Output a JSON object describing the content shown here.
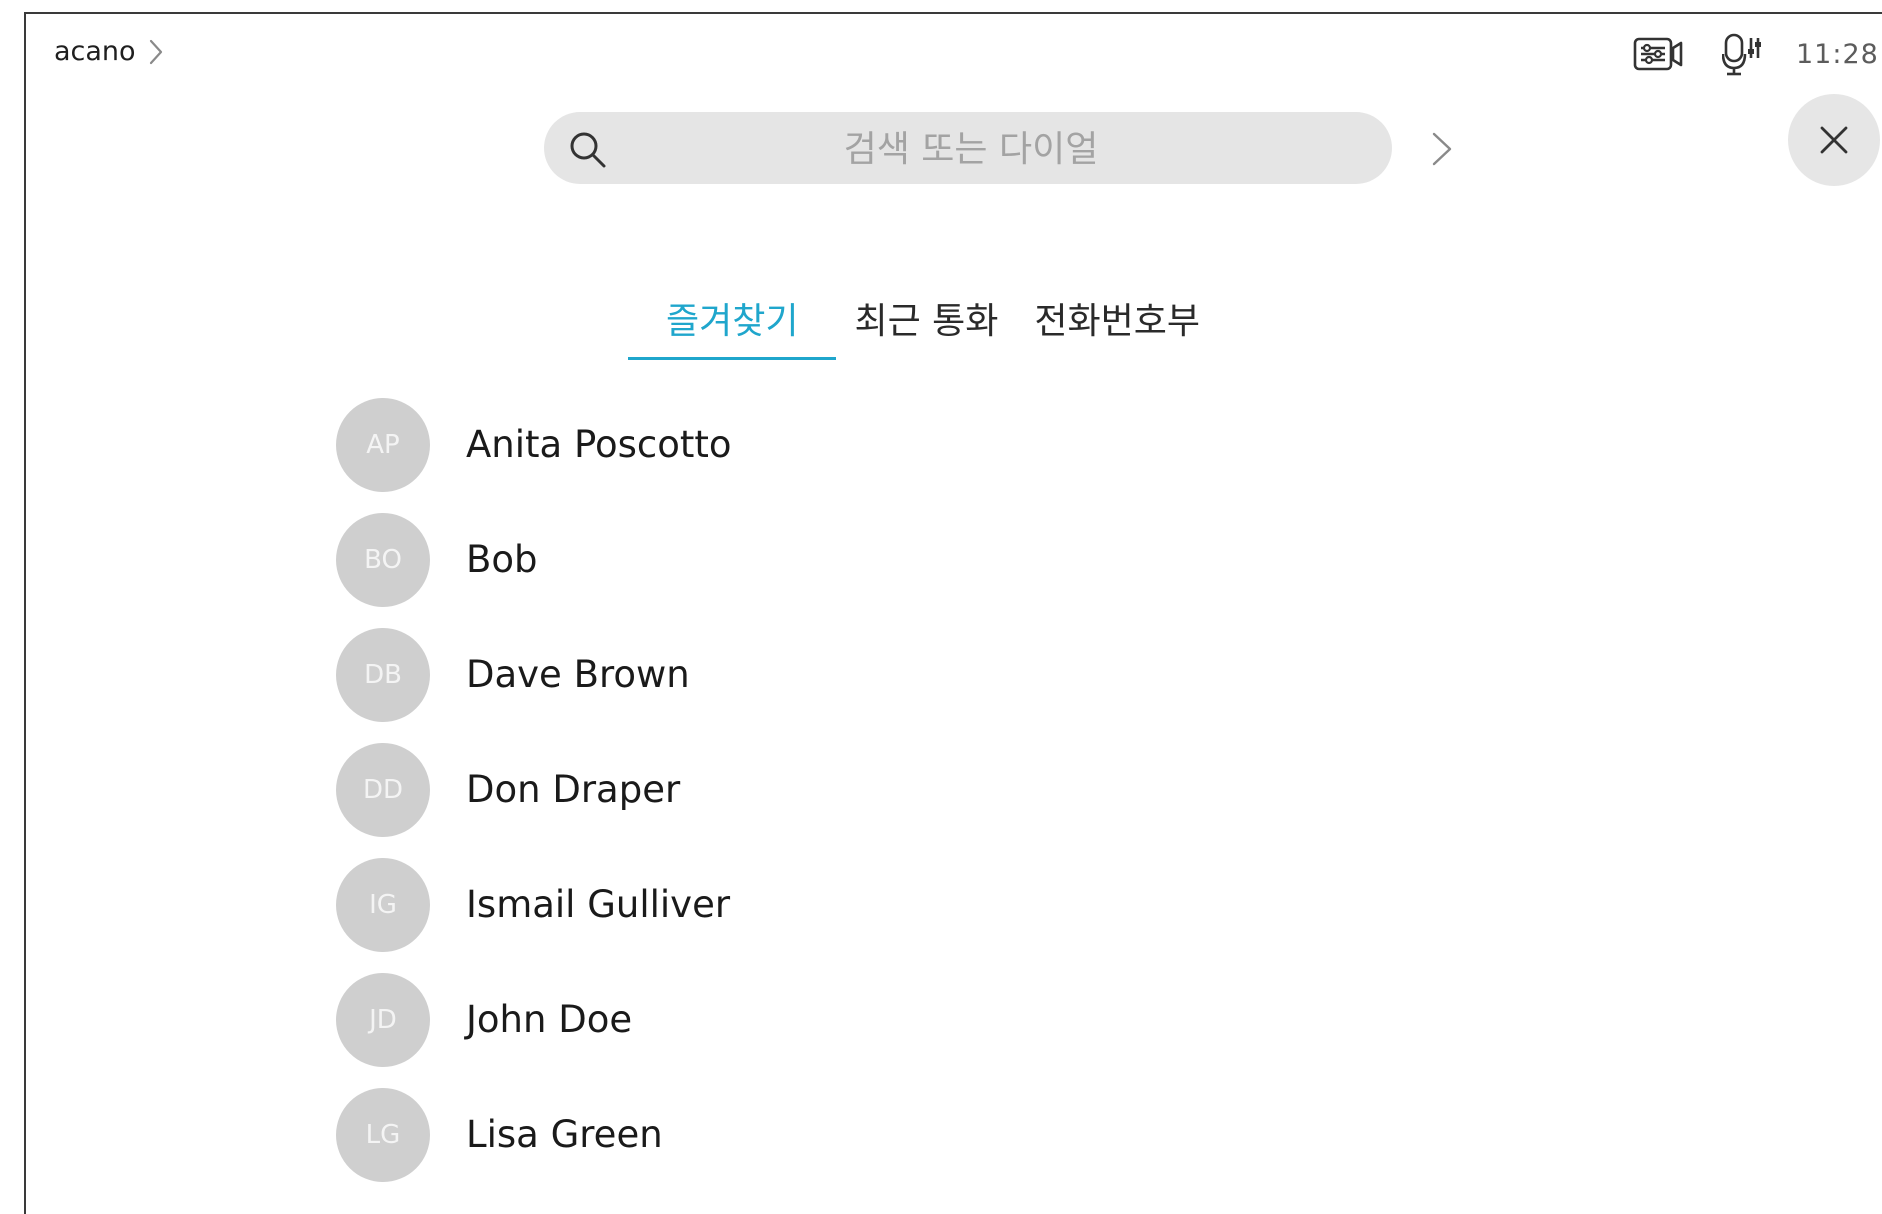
{
  "header": {
    "breadcrumb_label": "acano",
    "clock": "11:28"
  },
  "icons": {
    "breadcrumb_chevron": "chevron-right-icon",
    "camera_settings": "camera-settings-icon",
    "mic_settings": "microphone-settings-icon",
    "search": "search-icon",
    "search_go": "chevron-right-icon",
    "close": "close-icon"
  },
  "search": {
    "placeholder": "검색 또는 다이얼",
    "value": ""
  },
  "tabs": [
    {
      "label": "즐겨찾기",
      "active": true
    },
    {
      "label": "최근 통화",
      "active": false
    },
    {
      "label": "전화번호부",
      "active": false
    }
  ],
  "contacts": [
    {
      "initials": "AP",
      "name": "Anita Poscotto"
    },
    {
      "initials": "BO",
      "name": "Bob"
    },
    {
      "initials": "DB",
      "name": "Dave Brown"
    },
    {
      "initials": "DD",
      "name": "Don Draper"
    },
    {
      "initials": "IG",
      "name": "Ismail Gulliver"
    },
    {
      "initials": "JD",
      "name": "John Doe"
    },
    {
      "initials": "LG",
      "name": "Lisa Green"
    }
  ],
  "colors": {
    "accent": "#1fa6cc",
    "avatar_bg": "#cfcfcf",
    "search_bg": "#e5e5e5"
  }
}
